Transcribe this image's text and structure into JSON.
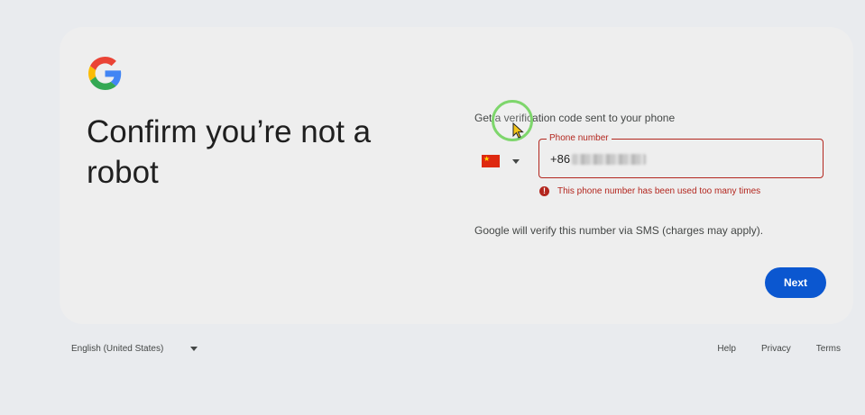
{
  "page": {
    "title": "Confirm you’re not a robot",
    "prompt": "Get a verification code sent to your phone",
    "sms_note": "Google will verify this number via SMS (charges may apply).",
    "next_label": "Next"
  },
  "phone": {
    "country_flag": "china-flag-icon",
    "legend": "Phone number",
    "value_prefix": "+86",
    "error": "This phone number has been used too many times",
    "error_color": "#b3261e"
  },
  "footer": {
    "language": "English (United States)",
    "links": [
      "Help",
      "Privacy",
      "Terms"
    ]
  },
  "colors": {
    "accent": "#0b57d0",
    "error": "#b3261e"
  }
}
